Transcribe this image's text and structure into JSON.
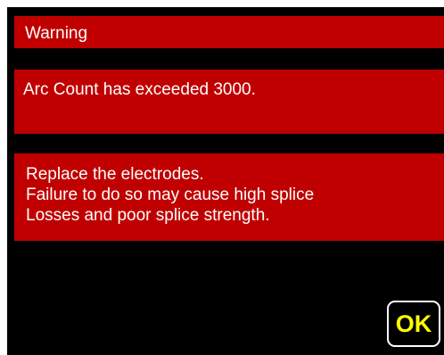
{
  "dialog": {
    "title": "Warning",
    "message": "Arc Count has exceeded 3000.",
    "instructions": [
      "Replace the electrodes.",
      "Failure to do so may cause high splice",
      "Losses and poor splice strength."
    ],
    "ok_label": "OK"
  },
  "colors": {
    "background": "#000000",
    "banner": "#c00000",
    "text": "#ffffff",
    "ok_text": "#ffff00",
    "ok_border": "#ffffff"
  }
}
